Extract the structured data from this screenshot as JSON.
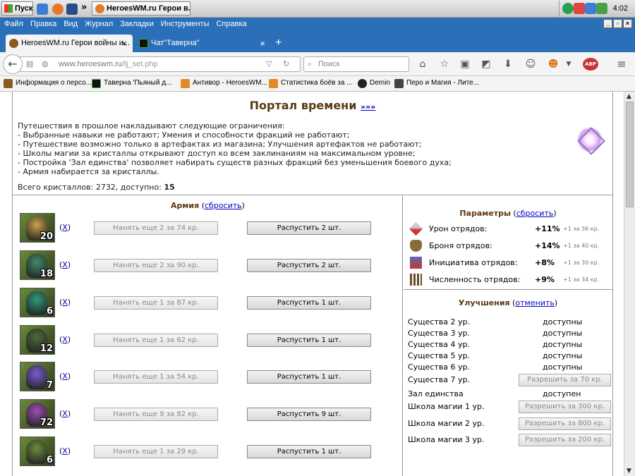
{
  "taskbar": {
    "start_label": "Пуск",
    "active_task": "HeroesWM.ru Герои в...",
    "clock": "4:02"
  },
  "menu": [
    "Файл",
    "Правка",
    "Вид",
    "Журнал",
    "Закладки",
    "Инструменты",
    "Справка"
  ],
  "tabs": [
    {
      "label": "HeroesWM.ru Герои войны и..."
    },
    {
      "label": "Чат\"Таверна\""
    }
  ],
  "address": {
    "host": "www.heroeswm.ru",
    "path": "/tj_set.php",
    "search_placeholder": "Поиск"
  },
  "bookmarks": [
    "Информация о персо...",
    "Таверна 'Пьяный д...",
    "Антивор - HeroesWM...",
    "Статистика боёв за ...",
    "Demin",
    "Перо и Магия - Лите..."
  ],
  "page": {
    "title": "Портал времени",
    "title_link": "»»»",
    "intro_lines": [
      "Путешествия в прошлое накладывают следующие ограничения:",
      "- Выбранные навыки не работают; Умения и способности фракций не работают;",
      "- Путешествие возможно только в артефактах из магазина; Улучшения артефактов не работают;",
      "- Школы магии за кристаллы открывают доступ ко всем заклинаниям на максимальном уровне;",
      "- Постройка 'Зал единства' позволяет набирать существ разных фракций без уменьшения боевого духа;",
      "- Армия набирается за кристаллы."
    ],
    "crystals_prefix": "Всего кристаллов: 2732, доступно:",
    "crystals_available": "15"
  },
  "army": {
    "title": "Армия",
    "reset_link": "сбросить",
    "remove_link": "X",
    "units": [
      {
        "count": "20",
        "hire_label": "Нанять еще 2 за 74 кр.",
        "dismiss_label": "Распустить 2 шт.",
        "color": "#c9a24a"
      },
      {
        "count": "18",
        "hire_label": "Нанять еще 2 за 90 кр.",
        "dismiss_label": "Распустить 2 шт.",
        "color": "#3f8a6a"
      },
      {
        "count": "6",
        "hire_label": "Нанять еще 1 за 87 кр.",
        "dismiss_label": "Распустить 1 шт.",
        "color": "#2f9a7a"
      },
      {
        "count": "12",
        "hire_label": "Нанять еще 1 за 62 кр.",
        "dismiss_label": "Распустить 1 шт.",
        "color": "#4e6a3a"
      },
      {
        "count": "7",
        "hire_label": "Нанять еще 1 за 54 кр.",
        "dismiss_label": "Распустить 1 шт.",
        "color": "#7a5ad0"
      },
      {
        "count": "72",
        "hire_label": "Нанять еще 9 за 82 кр.",
        "dismiss_label": "Распустить 9 шт.",
        "color": "#9a4fb0"
      },
      {
        "count": "6",
        "hire_label": "Нанять еще 1 за 29 кр.",
        "dismiss_label": "Распустить 1 шт.",
        "color": "#6e8a3a"
      }
    ]
  },
  "params": {
    "title": "Параметры",
    "reset_link": "сбросить",
    "rows": [
      {
        "label": "Урон отрядов:",
        "value": "+11%",
        "cost": "+1 за 36 кр."
      },
      {
        "label": "Броня отрядов:",
        "value": "+14%",
        "cost": "+1 за 40 кр."
      },
      {
        "label": "Инициатива отрядов:",
        "value": "+8%",
        "cost": "+1 за 30 кр."
      },
      {
        "label": "Численность отрядов:",
        "value": "+9%",
        "cost": "+1 за 34 кр."
      }
    ]
  },
  "upgrades": {
    "title": "Улучшения",
    "cancel_link": "отменить",
    "rows": [
      {
        "name": "Существа 2 ур.",
        "state": "доступны"
      },
      {
        "name": "Существа 3 ур.",
        "state": "доступны"
      },
      {
        "name": "Существа 4 ур.",
        "state": "доступны"
      },
      {
        "name": "Существа 5 ур.",
        "state": "доступны"
      },
      {
        "name": "Существа 6 ур.",
        "state": "доступны"
      },
      {
        "name": "Существа 7 ур.",
        "button": "Разрешить за 70 кр."
      },
      {
        "name": "Зал единства",
        "state": "доступен"
      },
      {
        "name": "Школа магии 1 ур.",
        "button": "Разрешить за 300 кр."
      },
      {
        "name": "Школа магии 2 ур.",
        "button": "Разрешить за 800 кр."
      },
      {
        "name": "Школа магии 3 ур.",
        "button": "Разрешить за 200 кр."
      }
    ]
  }
}
